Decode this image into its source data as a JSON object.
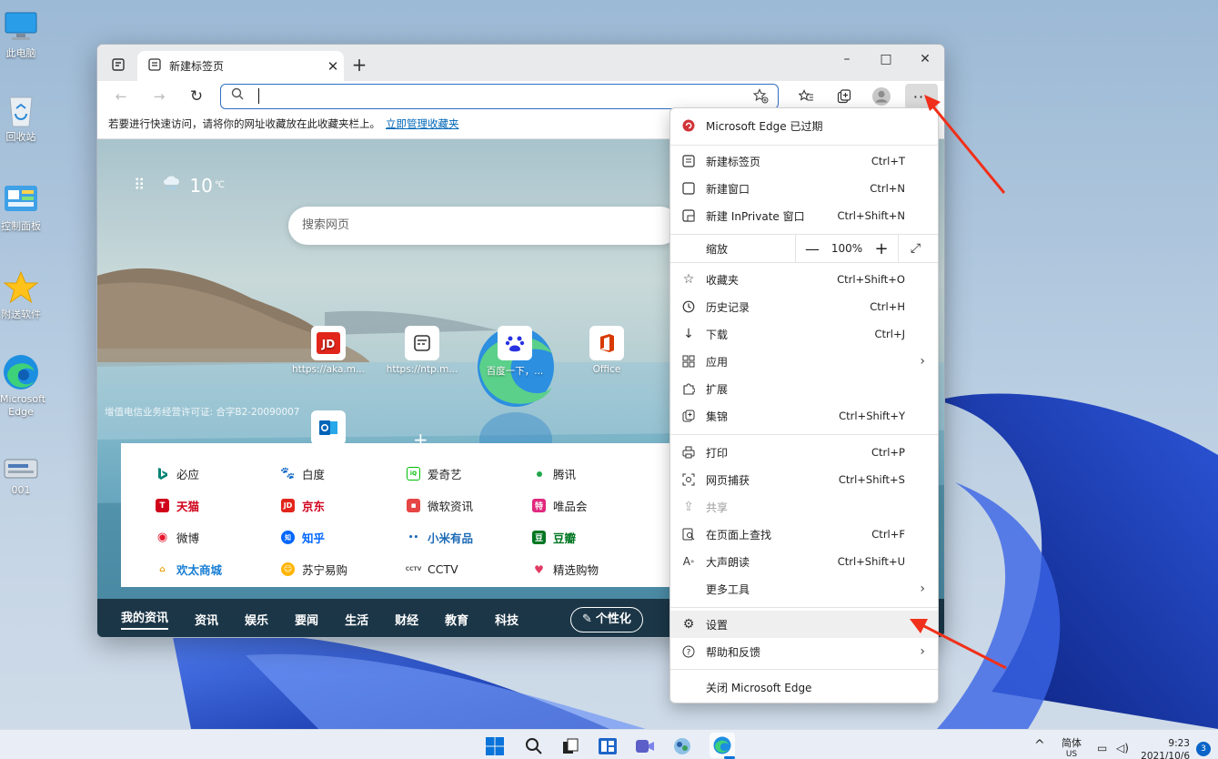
{
  "desktop": {
    "icons": [
      {
        "label": "此电脑",
        "icon": "computer-icon"
      },
      {
        "label": "回收站",
        "icon": "recycle-bin-icon"
      },
      {
        "label": "控制面板",
        "icon": "control-panel-icon"
      },
      {
        "label": "附送软件",
        "icon": "star-icon"
      },
      {
        "label": "Microsoft Edge",
        "icon": "edge-icon"
      },
      {
        "label": "001",
        "icon": "drive-icon"
      }
    ]
  },
  "browser": {
    "tab_title": "新建标签页",
    "address_placeholder": "",
    "favorites_hint": "若要进行快速访问，请将你的网址收藏放在此收藏夹栏上。",
    "favorites_link": "立即管理收藏夹",
    "window_controls": {
      "minimize": "–",
      "maximize": "□",
      "close": "✕"
    }
  },
  "newtab": {
    "temperature": "10",
    "temp_unit": "℃",
    "search_placeholder": "搜索网页",
    "quick_links": [
      {
        "label": "https://aka.m...",
        "icon": "jd-icon"
      },
      {
        "label": "https://ntp.m...",
        "icon": "ntp-icon"
      },
      {
        "label": "百度一下，...",
        "icon": "baidu-icon"
      },
      {
        "label": "Office",
        "icon": "office-icon"
      }
    ],
    "icp": "增值电信业务经营许可证: 合字B2-20090007",
    "links": [
      [
        "必应",
        "白度",
        "爱奇艺",
        "腾讯"
      ],
      [
        "天猫",
        "京东",
        "微软资讯",
        "唯品会"
      ],
      [
        "微博",
        "知乎",
        "小米有品",
        "豆瓣"
      ],
      [
        "欢太商城",
        "苏宁易购",
        "CCTV",
        "精选购物"
      ]
    ],
    "news_tabs": [
      "我的资讯",
      "资讯",
      "娱乐",
      "要闻",
      "生活",
      "财经",
      "教育",
      "科技"
    ],
    "personalize": "个性化"
  },
  "menu": {
    "expired": "Microsoft Edge 已过期",
    "items": [
      {
        "label": "新建标签页",
        "shortcut": "Ctrl+T",
        "icon": "new-tab-icon"
      },
      {
        "label": "新建窗口",
        "shortcut": "Ctrl+N",
        "icon": "new-window-icon"
      },
      {
        "label": "新建 InPrivate 窗口",
        "shortcut": "Ctrl+Shift+N",
        "icon": "inprivate-icon"
      }
    ],
    "zoom_label": "缩放",
    "zoom_value": "100%",
    "items2": [
      {
        "label": "收藏夹",
        "shortcut": "Ctrl+Shift+O",
        "icon": "favorites-icon"
      },
      {
        "label": "历史记录",
        "shortcut": "Ctrl+H",
        "icon": "history-icon"
      },
      {
        "label": "下载",
        "shortcut": "Ctrl+J",
        "icon": "download-icon"
      },
      {
        "label": "应用",
        "shortcut": "",
        "icon": "apps-icon"
      },
      {
        "label": "扩展",
        "shortcut": "",
        "icon": "extensions-icon"
      },
      {
        "label": "集锦",
        "shortcut": "Ctrl+Shift+Y",
        "icon": "collections-icon"
      }
    ],
    "items3": [
      {
        "label": "打印",
        "shortcut": "Ctrl+P",
        "icon": "print-icon"
      },
      {
        "label": "网页捕获",
        "shortcut": "Ctrl+Shift+S",
        "icon": "capture-icon"
      },
      {
        "label": "共享",
        "shortcut": "",
        "icon": "share-icon"
      },
      {
        "label": "在页面上查找",
        "shortcut": "Ctrl+F",
        "icon": "find-icon"
      },
      {
        "label": "大声朗读",
        "shortcut": "Ctrl+Shift+U",
        "icon": "read-aloud-icon"
      },
      {
        "label": "更多工具",
        "shortcut": "",
        "icon": ""
      }
    ],
    "settings": "设置",
    "help": "帮助和反馈",
    "close": "关闭 Microsoft Edge"
  },
  "taskbar": {
    "lang": "简体",
    "locale": "US",
    "time": "9:23",
    "date": "2021/10/6",
    "badge": "3"
  }
}
